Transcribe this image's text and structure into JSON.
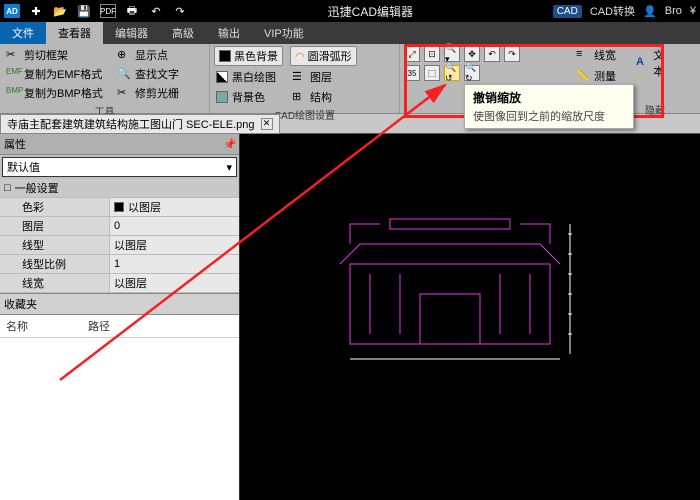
{
  "titlebar": {
    "app": "迅捷CAD编辑器",
    "convert": "CAD转换",
    "user": "Bro",
    "cad_badge": "CAD",
    "currency": "¥",
    "logo": "AD"
  },
  "tabs": {
    "file": "文件",
    "viewer": "查看器",
    "editor": "编辑器",
    "advanced": "高级",
    "output": "输出",
    "vip": "VIP功能"
  },
  "ribbon": {
    "tools": {
      "cut_frame": "剪切框架",
      "copy_emf": "复制为EMF格式",
      "copy_bmp": "复制为BMP格式",
      "show_point": "显示点",
      "find_text": "查找文字",
      "trim_grid": "修剪光栅",
      "label": "工具"
    },
    "cad": {
      "black_bg": "黑色背景",
      "bw_draw": "黑白绘图",
      "bg_color": "背景色",
      "arc": "圆滑弧形",
      "layer": "图层",
      "struct": "结构",
      "label": "CAD绘图设置"
    },
    "right": {
      "line": "线宽",
      "measure": "测量",
      "text": "文本",
      "hide": "隐藏"
    }
  },
  "doc": {
    "name": "寺庙主配套建筑建筑结构施工图山门 SEC-ELE.png"
  },
  "props": {
    "title": "属性",
    "default": "默认值",
    "general": "一般设置",
    "rows": [
      {
        "k": "色彩",
        "v": "以图层",
        "sw": "#000"
      },
      {
        "k": "图层",
        "v": "0"
      },
      {
        "k": "线型",
        "v": "以图层"
      },
      {
        "k": "线型比例",
        "v": "1"
      },
      {
        "k": "线宽",
        "v": "以图层"
      }
    ],
    "expand": "□"
  },
  "fav": {
    "title": "收藏夹",
    "col1": "名称",
    "col2": "路径"
  },
  "tooltip": {
    "title": "撤销缩放",
    "desc": "使图像回到之前的缩放尺度"
  }
}
